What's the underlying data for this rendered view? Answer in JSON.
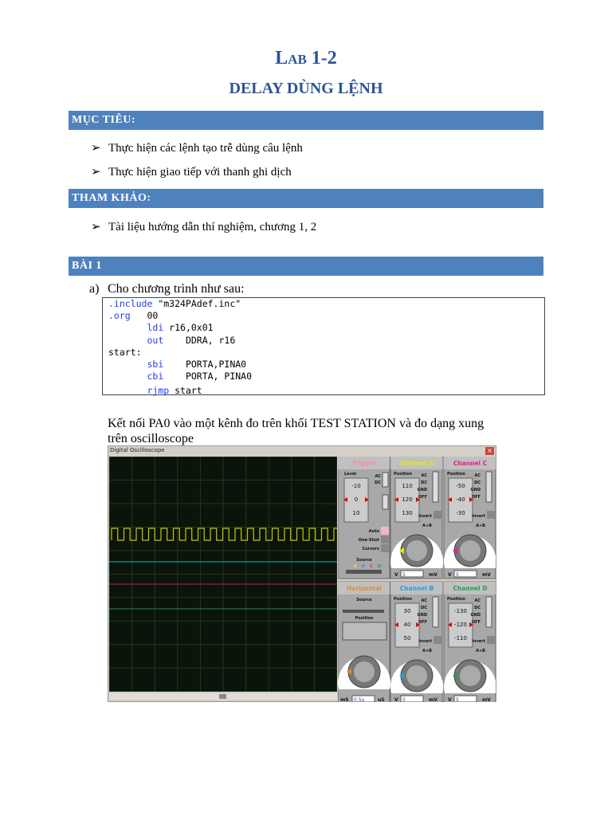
{
  "title": "Lab 1-2",
  "subtitle": "DELAY DÙNG LỆNH",
  "sections": [
    {
      "heading": "MỤC TIÊU:",
      "items": [
        "Thực hiện các lệnh tạo trễ dùng câu lệnh",
        "Thực hiện giao tiếp với thanh ghi dịch"
      ]
    },
    {
      "heading": "THAM KHẢO:",
      "items": [
        "Tài liệu hướng dẫn thí nghiệm, chương 1, 2"
      ]
    },
    {
      "heading": "BÀI 1"
    }
  ],
  "exercise": {
    "marker": "a)",
    "intro": "Cho chương trình như sau:",
    "code": [
      {
        "kw": ".include",
        "rest": " \"m324PAdef.inc\"",
        "indent": ""
      },
      {
        "kw": ".org",
        "rest": "   00",
        "indent": ""
      },
      {
        "kw": "ldi",
        "rest": " r16,0x01",
        "indent": "       "
      },
      {
        "kw": "out",
        "rest": "    DDRA, r16",
        "indent": "       "
      },
      {
        "kw": "",
        "rest": "start:",
        "indent": ""
      },
      {
        "kw": "sbi",
        "rest": "    PORTA,PINA0",
        "indent": "       "
      },
      {
        "kw": "cbi",
        "rest": "    PORTA, PINA0",
        "indent": "       "
      },
      {
        "kw": "",
        "rest": "",
        "indent": ""
      },
      {
        "kw": "rjmp",
        "rest": " start",
        "indent": "       "
      }
    ],
    "instruction": "Kết nối PA0 vào một kênh đo trên khối TEST STATION và đo dạng xung trên oscilloscope"
  },
  "oscilloscope": {
    "window_title": "Digital Oscilloscope",
    "close_icon": "close-icon",
    "trigger": {
      "label": "Trigger",
      "level_label": "Level",
      "level_values": [
        "-10",
        "0",
        "10"
      ],
      "ac": "AC",
      "dc": "DC",
      "auto": "Auto",
      "one_shot": "One-Shot",
      "cursors": "Cursors",
      "source_label": "Source",
      "sources": [
        "A",
        "B",
        "C",
        "D"
      ]
    },
    "horizontal": {
      "label": "Horizontal",
      "source_label": "Source",
      "position_label": "Position",
      "timebase": "0.5u",
      "unit_left": "mS",
      "unit_right": "uS"
    },
    "channels": [
      {
        "label": "Channel A",
        "color": "#e8e800",
        "position_label": "Position",
        "values": [
          "110",
          "120",
          "130"
        ],
        "volts": "5"
      },
      {
        "label": "Channel C",
        "color": "#e0208c",
        "position_label": "Position",
        "values": [
          "-50",
          "-40",
          "-30"
        ],
        "volts": "5"
      },
      {
        "label": "Channel B",
        "color": "#2a9be0",
        "position_label": "Position",
        "values": [
          "30",
          "40",
          "50"
        ],
        "volts": "5"
      },
      {
        "label": "Channel D",
        "color": "#20a050",
        "position_label": "Position",
        "values": [
          "-130",
          "-120",
          "-110"
        ],
        "volts": "5"
      }
    ],
    "coupling": [
      "AC",
      "DC",
      "GND",
      "OFF"
    ],
    "invert": "Invert",
    "a_plus_b": "A+B",
    "unit_v": "V",
    "unit_mv": "mV",
    "trace_colors": {
      "a": "#c8c800",
      "b": "#2aa8c0",
      "c": "#c02050",
      "d": "#208850"
    }
  }
}
